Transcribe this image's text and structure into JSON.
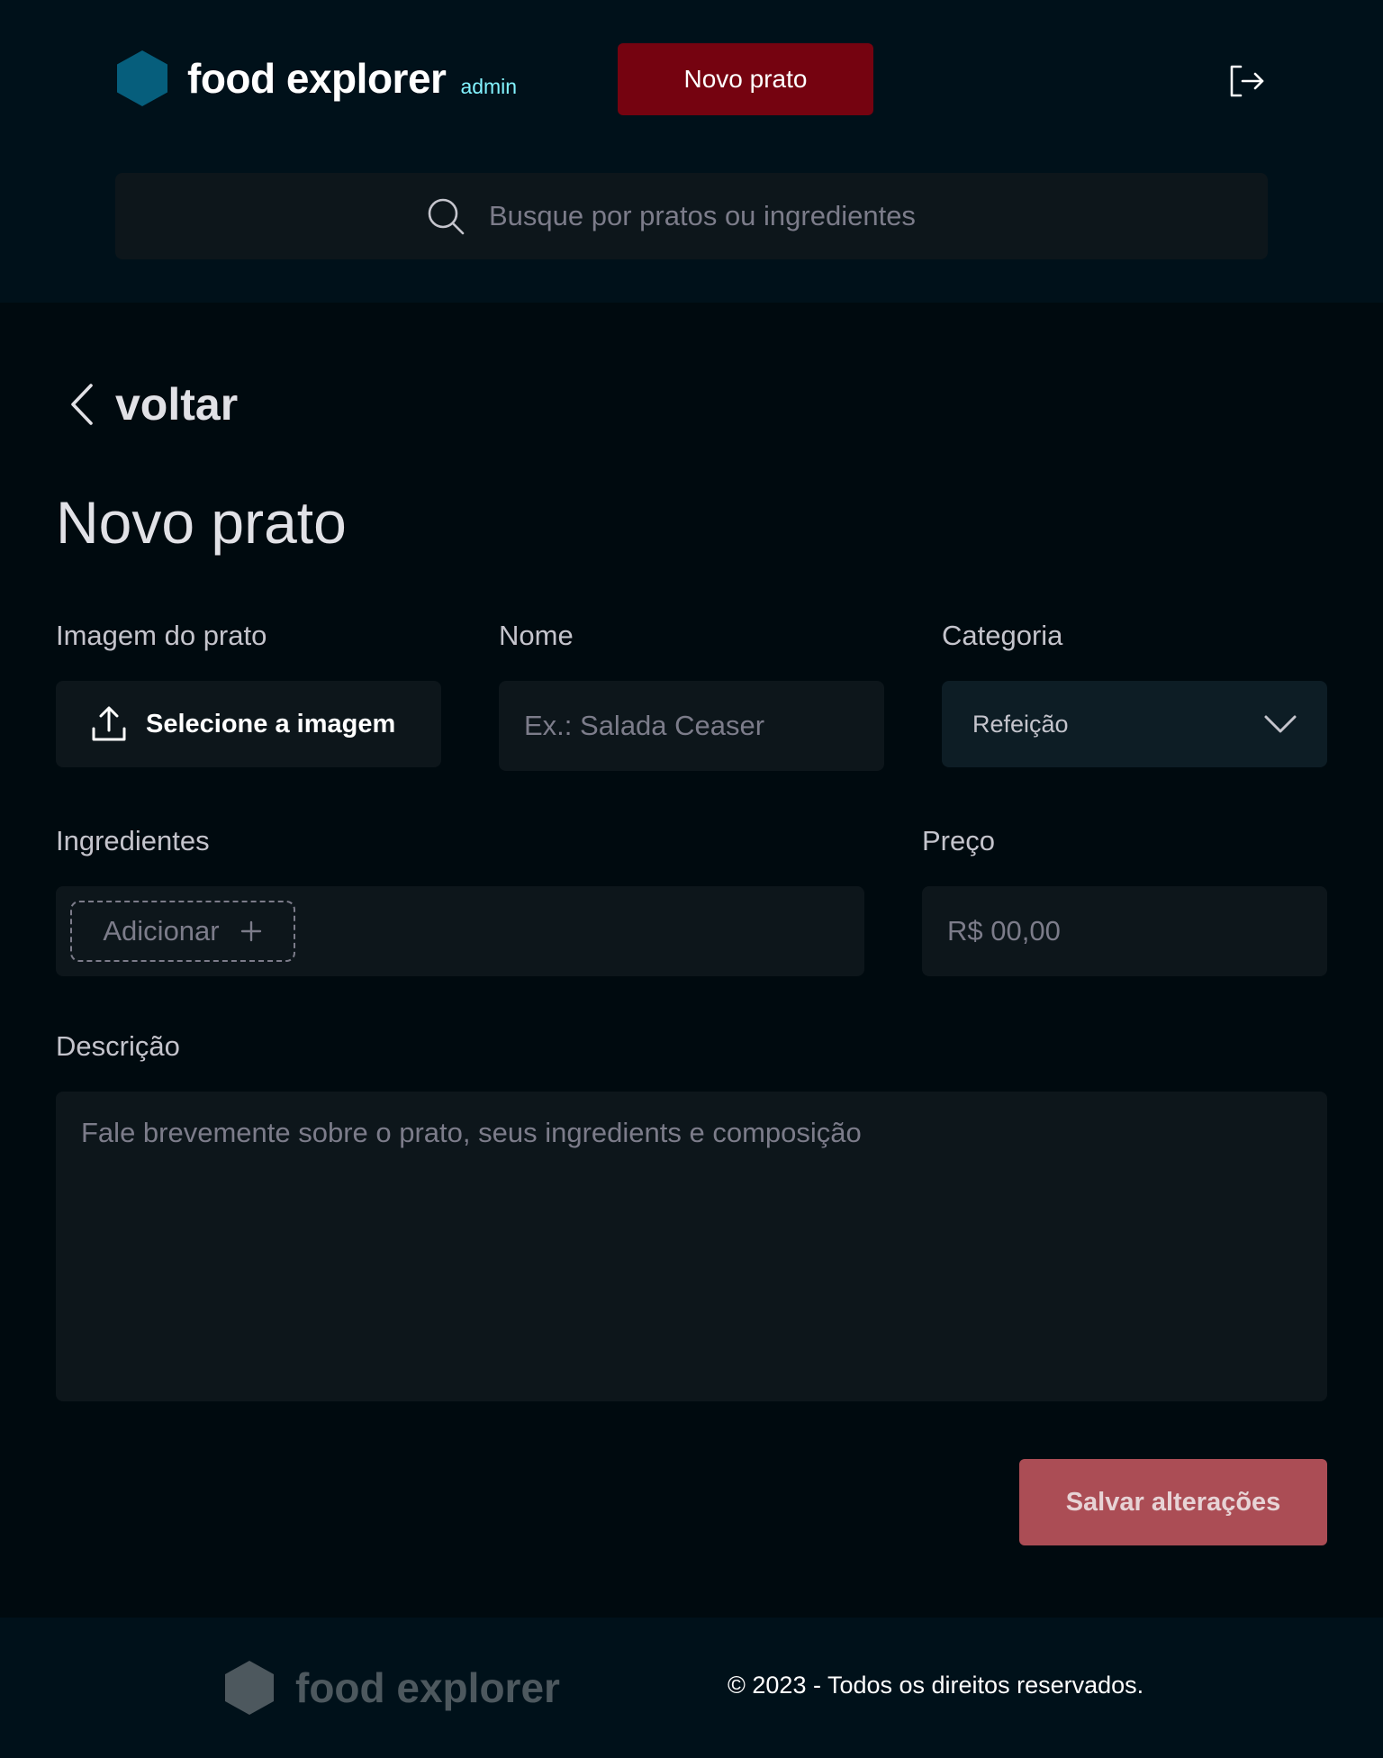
{
  "header": {
    "brand": "food explorer",
    "role_badge": "admin",
    "new_dish_label": "Novo prato",
    "search_placeholder": "Busque por pratos ou ingredientes"
  },
  "nav": {
    "back_label": "voltar"
  },
  "form": {
    "title": "Novo prato",
    "image": {
      "label": "Imagem do prato",
      "button_label": "Selecione a imagem"
    },
    "name": {
      "label": "Nome",
      "value": "",
      "placeholder": "Ex.: Salada Ceaser"
    },
    "category": {
      "label": "Categoria",
      "selected": "Refeição"
    },
    "ingredients": {
      "label": "Ingredientes",
      "add_label": "Adicionar"
    },
    "price": {
      "label": "Preço",
      "value": "",
      "placeholder": "R$ 00,00"
    },
    "description": {
      "label": "Descrição",
      "value": "",
      "placeholder": "Fale brevemente sobre o prato, seus ingredients e composição"
    },
    "save_label": "Salvar alterações"
  },
  "footer": {
    "brand": "food explorer",
    "copyright": "© 2023 - Todos os direitos reservados."
  },
  "colors": {
    "header_bg": "#00111a",
    "page_bg": "#000a0f",
    "primary_button": "#750310",
    "save_button": "#ab4d55",
    "admin_accent": "#82f3ff",
    "logo_hex": "#065e7c",
    "footer_hex": "#4d585e"
  },
  "icons": [
    "hexagon-logo-icon",
    "sign-out-icon",
    "search-icon",
    "chevron-left-icon",
    "upload-icon",
    "chevron-down-icon",
    "plus-icon"
  ]
}
